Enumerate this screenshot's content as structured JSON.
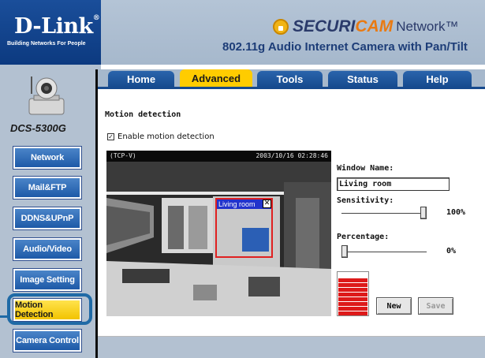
{
  "header": {
    "logo": "D-Link",
    "logo_mark": "®",
    "logo_tagline": "Building Networks For People",
    "brand_part1": "SECURI",
    "brand_part2": "CAM",
    "brand_part3": "Network",
    "brand_tm": "™",
    "product_title": "802.11g Audio Internet Camera with Pan/Tilt"
  },
  "sidebar": {
    "model": "DCS-5300G",
    "items": [
      {
        "label": "Network",
        "active": false
      },
      {
        "label": "Mail&FTP",
        "active": false
      },
      {
        "label": "DDNS&UPnP",
        "active": false
      },
      {
        "label": "Audio/Video",
        "active": false
      },
      {
        "label": "Image Setting",
        "active": false
      },
      {
        "label": "Motion Detection",
        "active": true
      },
      {
        "label": "Camera Control",
        "active": false
      }
    ]
  },
  "tabs": [
    {
      "label": "Home",
      "active": false
    },
    {
      "label": "Advanced",
      "active": true
    },
    {
      "label": "Tools",
      "active": false
    },
    {
      "label": "Status",
      "active": false
    },
    {
      "label": "Help",
      "active": false
    }
  ],
  "main": {
    "section_title": "Motion detection",
    "enable_label": "Enable motion detection",
    "enable_checked": true,
    "video": {
      "tag": "(TCP-V)",
      "timestamp": "2003/10/16 02:28:46",
      "window_title": "Living room",
      "close_glyph": "✕"
    },
    "window_name_label": "Window Name:",
    "window_name_value": "Living room",
    "sensitivity_label": "Sensitivity:",
    "sensitivity_value": "100%",
    "sensitivity_level": 1.0,
    "percentage_label": "Percentage:",
    "percentage_value": "0%",
    "percentage_level": 0.0,
    "new_button": "New",
    "save_button": "Save"
  },
  "colors": {
    "brand_blue": "#164a8e",
    "active_yellow": "#ffcc00",
    "level_red": "#dd1a1a",
    "window_border": "#e02020"
  }
}
